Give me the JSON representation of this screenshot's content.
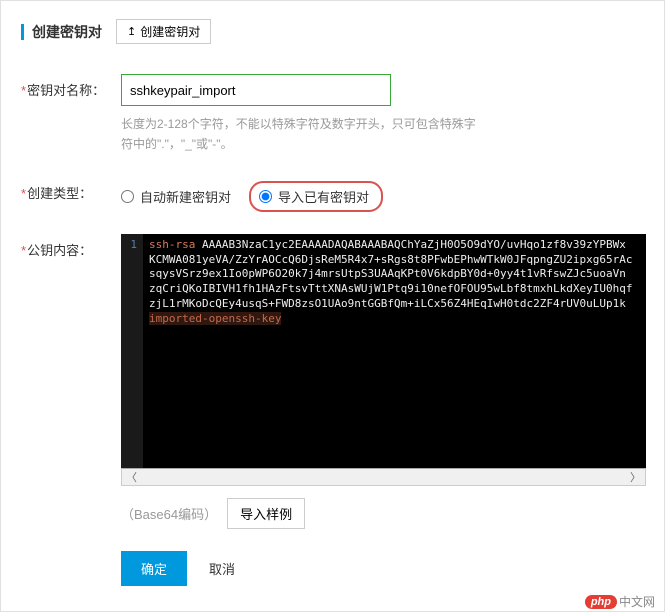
{
  "header": {
    "title": "创建密钥对",
    "createButton": "创建密钥对"
  },
  "form": {
    "nameLabel": "密钥对名称：",
    "nameValue": "sshkeypair_import",
    "nameHint": "长度为2-128个字符，不能以特殊字符及数字开头，只可包含特殊字符中的\".\"，\"_\"或\"-\"。",
    "typeLabel": "创建类型：",
    "radioAuto": "自动新建密钥对",
    "radioImport": "导入已有密钥对",
    "pubkeyLabel": "公钥内容：",
    "encodingLabel": "（Base64编码）",
    "importSample": "导入样例"
  },
  "code": {
    "lineNumber": "1",
    "keyType": "ssh-rsa",
    "keyBody": "AAAAB3NzaC1yc2EAAAADAQABAAABAQChYaZjH0O5O9dYO/uvHqo1zf8v39zYPBWx\nKCMWA081yeVA/ZzYrAOCcQ6DjsReM5R4x7+sRgs8t8PFwbEPhwWTkW0JFqpngZU2ipxg65rAc\nsqysVSrz9ex1Io0pWP6O20k7j4mrsUtpS3UAAqKPt0V6kdpBY0d+0yy4t1vRfswZJc5uoaVn\nzqCriQKoIBIVH1fh1HAzFtsvTttXNAsWUjW1Ptq9i10nefOFOU95wLbf8tmxhLkdXeyIU0hqf\nzjL1rMKoDcQEy4usqS+FWD8zsO1UAo9ntGGBfQm+iLCx56Z4HEqIwH0tdc2ZF4rUV0uLUp1k",
    "keyComment": "imported-openssh-key"
  },
  "actions": {
    "ok": "确定",
    "cancel": "取消"
  },
  "watermark": {
    "badge": "php",
    "text": "中文网"
  }
}
